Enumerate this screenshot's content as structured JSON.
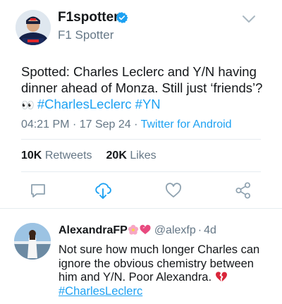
{
  "tweet": {
    "display_name": "F1spotter",
    "handle": "F1 Spotter",
    "text_main": "Spotted: Charles Leclerc and Y/N having dinner ahead of Monza. Still just ‘friends’?",
    "text_emoji": "👀",
    "hashtags": [
      "#CharlesLeclerc",
      "#YN"
    ],
    "time": "04:21 PM",
    "date": "17 Sep 24",
    "client": "Twitter for Android",
    "retweet_count": "10K",
    "retweet_label": "Retweets",
    "like_count": "20K",
    "like_label": "Likes",
    "icons": {
      "verified": "verified-badge-icon",
      "more": "chevron-down-icon",
      "reply": "reply-icon",
      "retweet": "retweet-cloud-icon",
      "like": "heart-icon",
      "share": "share-icon"
    }
  },
  "reply": {
    "display_name": "AlexandraFP",
    "name_emojis": [
      "🌸",
      "💗"
    ],
    "handle": "@alexfp",
    "age": "4d",
    "text_main": "Not sure how much longer Charles can ignore the obvious chemistry between him and Y/N. Poor Alexandra.",
    "text_emoji": "💔",
    "hashtag": "#CharlesLeclerc"
  },
  "colors": {
    "accent": "#1da1f2",
    "text": "#14171a",
    "muted": "#657786",
    "divider": "#e6ecf0"
  }
}
